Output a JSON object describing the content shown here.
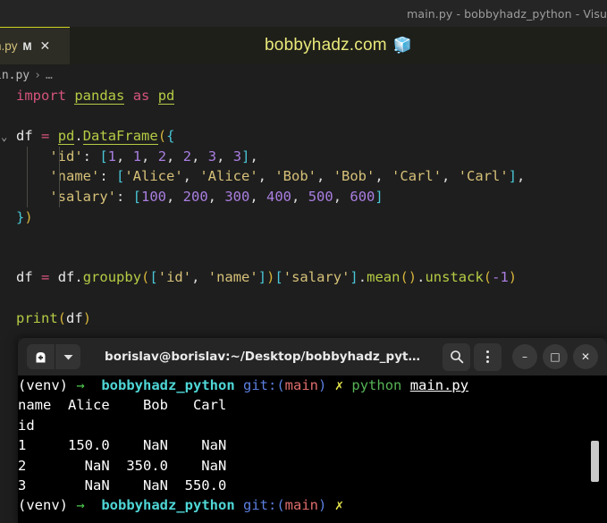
{
  "window": {
    "title": "main.py - bobbyhadz_python - Visu"
  },
  "tab": {
    "label": "n.py",
    "modified_badge": "M",
    "close_icon": "✕"
  },
  "banner": {
    "text": "bobbyhadz.com",
    "icon": "🧊"
  },
  "breadcrumb": {
    "file": "in.py",
    "separator": "›",
    "more": "…"
  },
  "editor": {
    "fold_chevron": "⌄",
    "lines": [
      {
        "id": "line-import",
        "indent_guides": [],
        "tokens": [
          {
            "cls": "t-kw",
            "text": "import"
          },
          {
            "cls": "t-plain",
            "text": " "
          },
          {
            "cls": "t-mod",
            "text": "pandas"
          },
          {
            "cls": "t-plain",
            "text": " "
          },
          {
            "cls": "t-kw",
            "text": "as"
          },
          {
            "cls": "t-plain",
            "text": " "
          },
          {
            "cls": "t-mod",
            "text": "pd"
          }
        ]
      },
      {
        "id": "line-blank-1",
        "indent_guides": [],
        "tokens": []
      },
      {
        "id": "line-df-assign",
        "fold": true,
        "indent_guides": [],
        "tokens": [
          {
            "cls": "t-var",
            "text": "df"
          },
          {
            "cls": "t-plain",
            "text": " "
          },
          {
            "cls": "t-op",
            "text": "="
          },
          {
            "cls": "t-plain",
            "text": " "
          },
          {
            "cls": "t-mod",
            "text": "pd"
          },
          {
            "cls": "t-plain",
            "text": "."
          },
          {
            "cls": "t-fn",
            "text": "DataFrame"
          },
          {
            "cls": "t-punct",
            "text": "("
          },
          {
            "cls": "t-brk",
            "text": "{"
          }
        ]
      },
      {
        "id": "line-id",
        "indent_guides": [
          30,
          66
        ],
        "tokens": [
          {
            "cls": "t-plain",
            "text": "    "
          },
          {
            "cls": "t-str",
            "text": "'id'"
          },
          {
            "cls": "t-plain",
            "text": ": "
          },
          {
            "cls": "t-brk",
            "text": "["
          },
          {
            "cls": "t-num",
            "text": "1"
          },
          {
            "cls": "t-plain",
            "text": ", "
          },
          {
            "cls": "t-num",
            "text": "1"
          },
          {
            "cls": "t-plain",
            "text": ", "
          },
          {
            "cls": "t-num",
            "text": "2"
          },
          {
            "cls": "t-plain",
            "text": ", "
          },
          {
            "cls": "t-num",
            "text": "2"
          },
          {
            "cls": "t-plain",
            "text": ", "
          },
          {
            "cls": "t-num",
            "text": "3"
          },
          {
            "cls": "t-plain",
            "text": ", "
          },
          {
            "cls": "t-num",
            "text": "3"
          },
          {
            "cls": "t-brk",
            "text": "]"
          },
          {
            "cls": "t-plain",
            "text": ","
          }
        ]
      },
      {
        "id": "line-name",
        "indent_guides": [
          30,
          66
        ],
        "tokens": [
          {
            "cls": "t-plain",
            "text": "    "
          },
          {
            "cls": "t-str",
            "text": "'name'"
          },
          {
            "cls": "t-plain",
            "text": ": "
          },
          {
            "cls": "t-brk",
            "text": "["
          },
          {
            "cls": "t-str",
            "text": "'Alice'"
          },
          {
            "cls": "t-plain",
            "text": ", "
          },
          {
            "cls": "t-str",
            "text": "'Alice'"
          },
          {
            "cls": "t-plain",
            "text": ", "
          },
          {
            "cls": "t-str",
            "text": "'Bob'"
          },
          {
            "cls": "t-plain",
            "text": ", "
          },
          {
            "cls": "t-str",
            "text": "'Bob'"
          },
          {
            "cls": "t-plain",
            "text": ", "
          },
          {
            "cls": "t-str",
            "text": "'Carl'"
          },
          {
            "cls": "t-plain",
            "text": ", "
          },
          {
            "cls": "t-str",
            "text": "'Carl'"
          },
          {
            "cls": "t-brk",
            "text": "]"
          },
          {
            "cls": "t-plain",
            "text": ","
          }
        ]
      },
      {
        "id": "line-salary",
        "indent_guides": [
          30,
          66
        ],
        "tokens": [
          {
            "cls": "t-plain",
            "text": "    "
          },
          {
            "cls": "t-str",
            "text": "'salary'"
          },
          {
            "cls": "t-plain",
            "text": ": "
          },
          {
            "cls": "t-brk",
            "text": "["
          },
          {
            "cls": "t-num",
            "text": "100"
          },
          {
            "cls": "t-plain",
            "text": ", "
          },
          {
            "cls": "t-num",
            "text": "200"
          },
          {
            "cls": "t-plain",
            "text": ", "
          },
          {
            "cls": "t-num",
            "text": "300"
          },
          {
            "cls": "t-plain",
            "text": ", "
          },
          {
            "cls": "t-num",
            "text": "400"
          },
          {
            "cls": "t-plain",
            "text": ", "
          },
          {
            "cls": "t-num",
            "text": "500"
          },
          {
            "cls": "t-plain",
            "text": ", "
          },
          {
            "cls": "t-num",
            "text": "600"
          },
          {
            "cls": "t-brk",
            "text": "]"
          }
        ]
      },
      {
        "id": "line-close-brace",
        "indent_guides": [],
        "tokens": [
          {
            "cls": "t-brk",
            "text": "}"
          },
          {
            "cls": "t-punct",
            "text": ")"
          }
        ]
      },
      {
        "id": "line-blank-2",
        "indent_guides": [],
        "tokens": []
      },
      {
        "id": "line-blank-3",
        "indent_guides": [],
        "tokens": []
      },
      {
        "id": "line-groupby",
        "indent_guides": [],
        "tokens": [
          {
            "cls": "t-var",
            "text": "df"
          },
          {
            "cls": "t-plain",
            "text": " "
          },
          {
            "cls": "t-op",
            "text": "="
          },
          {
            "cls": "t-plain",
            "text": " "
          },
          {
            "cls": "t-var",
            "text": "df"
          },
          {
            "cls": "t-plain",
            "text": "."
          },
          {
            "cls": "t-fn2",
            "text": "groupby"
          },
          {
            "cls": "t-punct",
            "text": "("
          },
          {
            "cls": "t-brk",
            "text": "["
          },
          {
            "cls": "t-str",
            "text": "'id'"
          },
          {
            "cls": "t-plain",
            "text": ", "
          },
          {
            "cls": "t-str",
            "text": "'name'"
          },
          {
            "cls": "t-brk",
            "text": "]"
          },
          {
            "cls": "t-punct",
            "text": ")"
          },
          {
            "cls": "t-brk",
            "text": "["
          },
          {
            "cls": "t-str",
            "text": "'salary'"
          },
          {
            "cls": "t-brk",
            "text": "]"
          },
          {
            "cls": "t-plain",
            "text": "."
          },
          {
            "cls": "t-fn2",
            "text": "mean"
          },
          {
            "cls": "t-punct",
            "text": "()"
          },
          {
            "cls": "t-plain",
            "text": "."
          },
          {
            "cls": "t-fn2",
            "text": "unstack"
          },
          {
            "cls": "t-punct",
            "text": "("
          },
          {
            "cls": "t-num",
            "text": "-1"
          },
          {
            "cls": "t-punct",
            "text": ")"
          }
        ]
      },
      {
        "id": "line-blank-4",
        "indent_guides": [],
        "tokens": []
      },
      {
        "id": "line-print",
        "indent_guides": [],
        "tokens": [
          {
            "cls": "t-fn2",
            "text": "print"
          },
          {
            "cls": "t-punct",
            "text": "("
          },
          {
            "cls": "t-var",
            "text": "df"
          },
          {
            "cls": "t-punct",
            "text": ")"
          }
        ]
      }
    ]
  },
  "terminal": {
    "title": "borislav@borislav:~/Desktop/bobbyhadz_pyt…",
    "icon_name": "terminal-icon",
    "dropdown_icon": "▼",
    "search_icon": "🔍",
    "minimize_label": "–",
    "maximize_label": "□",
    "close_label": "✕",
    "lines": [
      {
        "id": "term-prompt-1",
        "segments": [
          {
            "cls": "c-white",
            "text": "(venv) "
          },
          {
            "cls": "c-green",
            "text": "→"
          },
          {
            "cls": "c-white",
            "text": "  "
          },
          {
            "cls": "c-cyan",
            "text": "bobbyhadz_python"
          },
          {
            "cls": "c-white",
            "text": " "
          },
          {
            "cls": "c-blue",
            "text": "git:("
          },
          {
            "cls": "c-red",
            "text": "main"
          },
          {
            "cls": "c-blue",
            "text": ")"
          },
          {
            "cls": "c-white",
            "text": " "
          },
          {
            "cls": "c-yellow",
            "text": "✗"
          },
          {
            "cls": "c-white",
            "text": " "
          },
          {
            "cls": "c-pygreen",
            "text": "python"
          },
          {
            "cls": "c-white",
            "text": " "
          },
          {
            "cls": "c-under",
            "text": "main.py"
          }
        ]
      },
      {
        "id": "term-out-header",
        "segments": [
          {
            "cls": "c-white",
            "text": "name  Alice    Bob   Carl"
          }
        ]
      },
      {
        "id": "term-out-index",
        "segments": [
          {
            "cls": "c-white",
            "text": "id"
          }
        ]
      },
      {
        "id": "term-out-row-1",
        "segments": [
          {
            "cls": "c-white",
            "text": "1     150.0    NaN    NaN"
          }
        ]
      },
      {
        "id": "term-out-row-2",
        "segments": [
          {
            "cls": "c-white",
            "text": "2       NaN  350.0    NaN"
          }
        ]
      },
      {
        "id": "term-out-row-3",
        "segments": [
          {
            "cls": "c-white",
            "text": "3       NaN    NaN  550.0"
          }
        ]
      },
      {
        "id": "term-prompt-2",
        "segments": [
          {
            "cls": "c-white",
            "text": "(venv) "
          },
          {
            "cls": "c-green",
            "text": "→"
          },
          {
            "cls": "c-white",
            "text": "  "
          },
          {
            "cls": "c-cyan",
            "text": "bobbyhadz_python"
          },
          {
            "cls": "c-white",
            "text": " "
          },
          {
            "cls": "c-blue",
            "text": "git:("
          },
          {
            "cls": "c-red",
            "text": "main"
          },
          {
            "cls": "c-blue",
            "text": ")"
          },
          {
            "cls": "c-white",
            "text": " "
          },
          {
            "cls": "c-yellow",
            "text": "✗"
          }
        ]
      }
    ]
  }
}
